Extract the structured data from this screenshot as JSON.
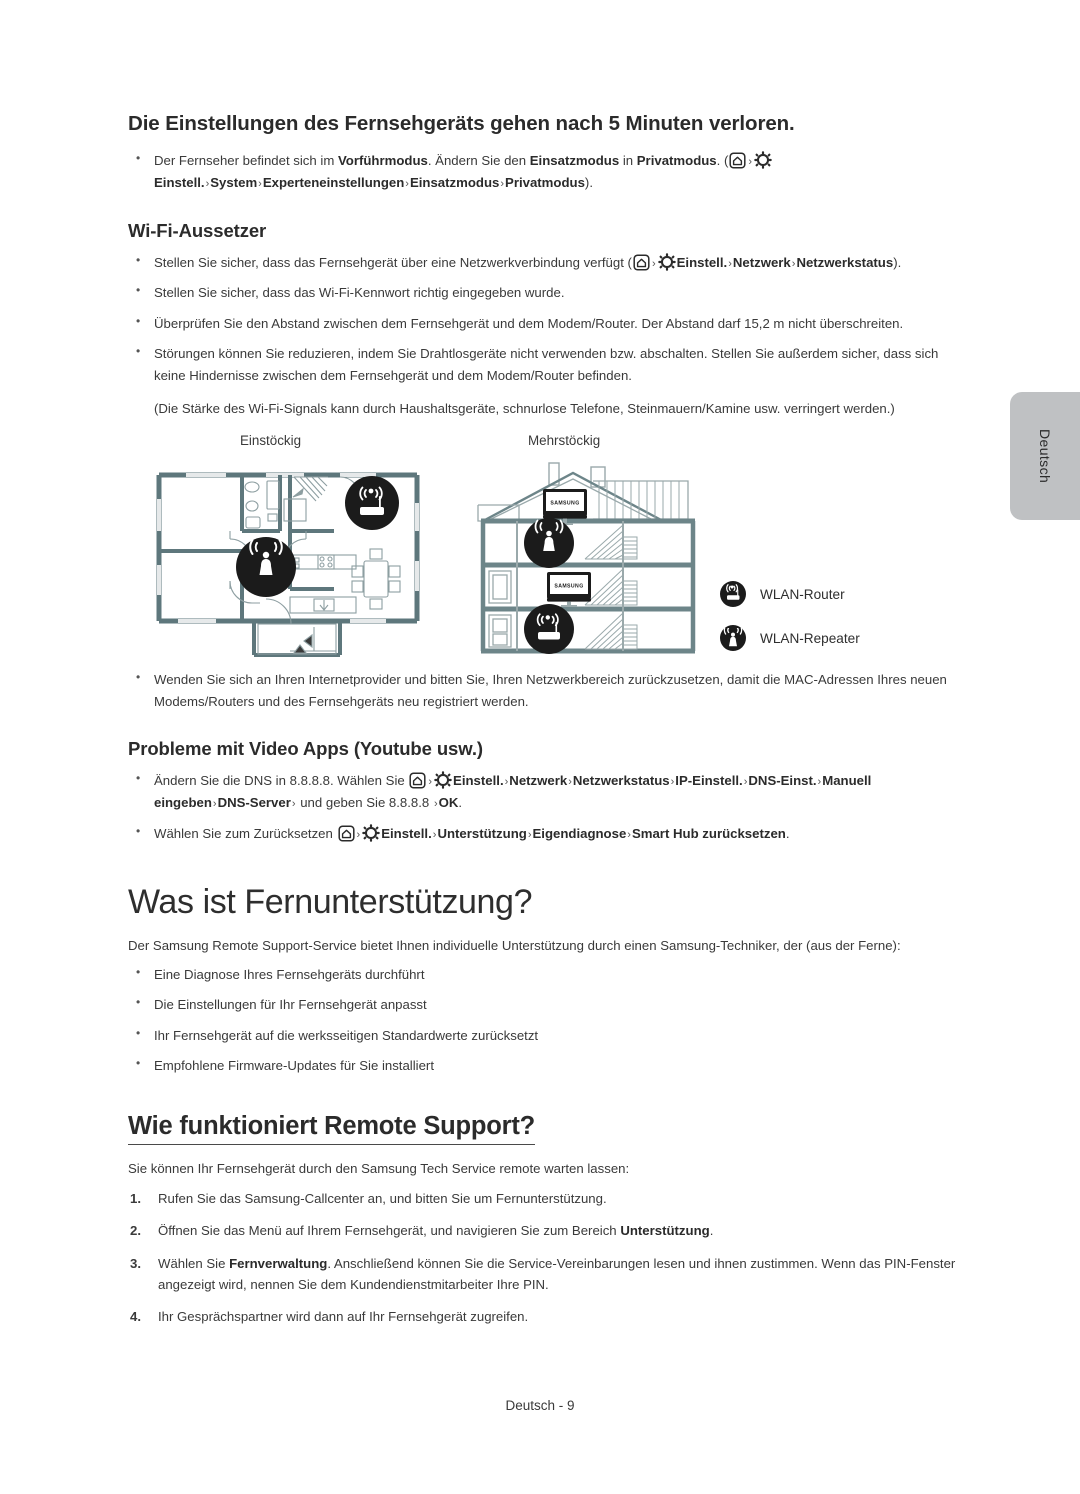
{
  "language_tab": {
    "label": "Deutsch"
  },
  "footer": {
    "text": "Deutsch - 9"
  },
  "section_settings_lost": {
    "heading": "Die Einstellungen des Fernsehgeräts gehen nach 5 Minuten verloren.",
    "bullet": {
      "part1": "Der Fernseher befindet sich im ",
      "b1": "Vorführmodus",
      "part2": ". Ändern Sie den ",
      "b2": "Einsatzmodus",
      "part3": " in ",
      "b3": "Privatmodus",
      "part4": ". (",
      "home_icon": "home-icon",
      "arrow1": "›",
      "gear_icon": "gear-icon",
      "b4": "Einstell.",
      "arrow2": "›",
      "b5": "System",
      "arrow3": "›",
      "b6": "Experteneinstellungen",
      "arrow4": "›",
      "b7": "Einsatzmodus",
      "arrow5": "›",
      "b8": "Privatmodus",
      "part5": ")."
    }
  },
  "section_wifi": {
    "heading": "Wi-Fi-Aussetzer",
    "bullet1": {
      "part1": "Stellen Sie sicher, dass das Fernsehgerät über eine Netzwerkverbindung verfügt (",
      "home_icon": "home-icon",
      "arrow1": "›",
      "gear_icon": "gear-icon",
      "b1": "Einstell.",
      "arrow2": "›",
      "b2": "Netzwerk",
      "arrow3": "›",
      "b3": "Netzwerkstatus",
      "part2": ")."
    },
    "bullet2": "Stellen Sie sicher, dass das Wi-Fi-Kennwort richtig eingegeben wurde.",
    "bullet3": "Überprüfen Sie den Abstand zwischen dem Fernsehgerät und dem Modem/Router. Der Abstand darf 15,2 m nicht überschreiten.",
    "bullet4": "Störungen können Sie reduzieren, indem Sie Drahtlosgeräte nicht verwenden bzw. abschalten. Stellen Sie außerdem sicher, dass sich keine Hindernisse zwischen dem Fernsehgerät und dem Modem/Router befinden.",
    "note": "(Die Stärke des Wi-Fi-Signals kann durch Haushaltsgeräte, schnurlose Telefone, Steinmauern/Kamine usw. verringert werden.)",
    "bullet5": "Wenden Sie sich an Ihren Internetprovider und bitten Sie, Ihren Netzwerkbereich zurückzusetzen, damit die MAC-Adressen Ihres neuen Modems/Routers und des Fernsehgeräts neu registriert werden."
  },
  "diagrams": {
    "caption_single": "Einstöckig",
    "caption_multi": "Mehrstöckig",
    "legend": [
      {
        "icon": "wlan-router-icon",
        "label": "WLAN-Router"
      },
      {
        "icon": "wlan-repeater-icon",
        "label": "WLAN-Repeater"
      }
    ],
    "tv_brand": "SAMSUNG",
    "wall_color": "#5e777c",
    "icon_badge_color": "#1b1b1b"
  },
  "section_video_apps": {
    "heading": "Probleme mit Video Apps (Youtube usw.)",
    "bullet1": {
      "part1": "Ändern Sie die DNS in 8.8.8.8. Wählen Sie ",
      "home_icon": "home-icon",
      "arrow1": "›",
      "gear_icon": "gear-icon",
      "b1": "Einstell.",
      "arrow2": "›",
      "b2": "Netzwerk",
      "arrow3": "›",
      "b3": "Netzwerkstatus",
      "arrow4": "›",
      "b4": "IP-Einstell.",
      "arrow5": "›",
      "b5": "DNS-Einst.",
      "arrow6": "›",
      "b6": "Manuell eingeben",
      "arrow7": "›",
      "b7": "DNS-Server",
      "arrow8": "›",
      "part2": " und geben Sie 8.8.8.8 ",
      "arrow9": "›",
      "b8": "OK",
      "part3": "."
    },
    "bullet2": {
      "part1": "Wählen Sie zum Zurücksetzen ",
      "home_icon": "home-icon",
      "arrow1": "›",
      "gear_icon": "gear-icon",
      "b1": "Einstell.",
      "arrow2": "›",
      "b2": "Unterstützung",
      "arrow3": "›",
      "b3": "Eigendiagnose",
      "arrow4": "›",
      "b4": "Smart Hub zurücksetzen",
      "part2": "."
    }
  },
  "section_remote_support": {
    "heading": "Was ist Fernunterstützung?",
    "lead": "Der Samsung Remote Support-Service bietet Ihnen individuelle Unterstützung durch einen Samsung-Techniker, der (aus der Ferne):",
    "bullets": [
      "Eine Diagnose Ihres Fernsehgeräts durchführt",
      "Die Einstellungen für Ihr Fernsehgerät anpasst",
      "Ihr Fernsehgerät auf die werksseitigen Standardwerte zurücksetzt",
      "Empfohlene Firmware-Updates für Sie installiert"
    ]
  },
  "section_how_remote": {
    "heading": "Wie funktioniert Remote Support?",
    "lead": "Sie können Ihr Fernsehgerät durch den Samsung Tech Service remote warten lassen:",
    "step1": "Rufen Sie das Samsung-Callcenter an, und bitten Sie um Fernunterstützung.",
    "step2": {
      "part1": "Öffnen Sie das Menü auf Ihrem Fernsehgerät, und navigieren Sie zum Bereich ",
      "b1": "Unterstützung",
      "part2": "."
    },
    "step3": {
      "part1": "Wählen Sie ",
      "b1": "Fernverwaltung",
      "part2": ". Anschließend können Sie die Service-Vereinbarungen lesen und ihnen zustimmen. Wenn das PIN-Fenster angezeigt wird, nennen Sie dem Kundendienstmitarbeiter Ihre PIN."
    },
    "step4": "Ihr Gesprächspartner wird dann auf Ihr Fernsehgerät zugreifen."
  }
}
